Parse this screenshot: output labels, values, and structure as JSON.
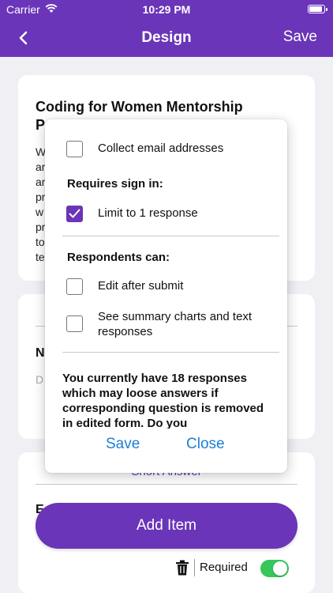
{
  "status": {
    "carrier": "Carrier",
    "time": "10:29 PM"
  },
  "nav": {
    "title": "Design",
    "save": "Save"
  },
  "colors": {
    "accent": "#6a35b8",
    "link": "#1a7fd6",
    "toggle_on": "#34c759"
  },
  "form": {
    "title_line1": "Coding for Women Mentorship",
    "title_line2_fragment": "P",
    "desc_fragments": [
      "W",
      "ar",
      "ar",
      "pr",
      "w",
      "pr",
      "to",
      "te"
    ]
  },
  "card2": {
    "n_fragment": "N",
    "d_fragment": "D"
  },
  "card3": {
    "short_answer": "Short Answer",
    "e_fragment": "E"
  },
  "add_item": "Add Item",
  "required_label": "Required",
  "required_on": true,
  "popup": {
    "collect_email": {
      "label": "Collect email addresses",
      "checked": false
    },
    "requires_sign_in": "Requires sign in:",
    "limit_one": {
      "label": "Limit to 1 response",
      "checked": true
    },
    "respondents_can": "Respondents can:",
    "edit_after": {
      "label": "Edit after submit",
      "checked": false
    },
    "see_summary": {
      "label": "See summary charts and text responses",
      "checked": false
    },
    "warning": "You currently have 18 responses which may loose answers if corresponding question is removed in edited form. Do you",
    "save": "Save",
    "close": "Close"
  }
}
